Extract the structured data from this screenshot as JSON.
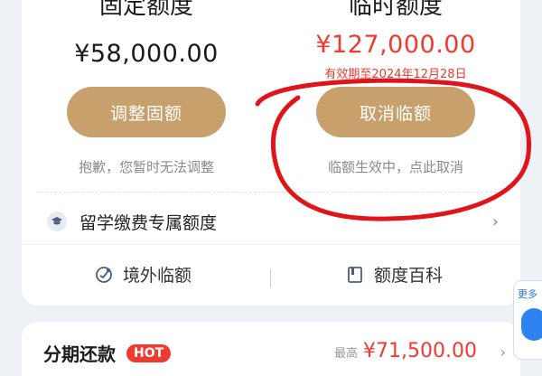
{
  "limits": {
    "fixed": {
      "title": "固定额度",
      "amount": "¥58,000.00",
      "button": "调整固额",
      "hint": "抱歉，您暂时无法调整"
    },
    "temporary": {
      "title": "临时额度",
      "amount": "¥127,000.00",
      "valid_until": "有效期至2024年12月28日",
      "button": "取消临额",
      "hint": "临额生效中，点此取消"
    }
  },
  "study_limit": {
    "label": "留学缴费专属额度",
    "icon": "graduation-cap-icon"
  },
  "quick_actions": [
    {
      "label": "境外临额",
      "icon": "overseas-limit-icon"
    },
    {
      "label": "额度百科",
      "icon": "book-icon"
    }
  ],
  "installment": {
    "title": "分期还款",
    "badge": "HOT",
    "due_label": "最高",
    "due_amount": "¥71,500.00"
  },
  "floating_widget": {
    "label": "更多"
  },
  "colors": {
    "accent_gold": "#c8a06c",
    "alert_red": "#ef3b2f",
    "annotation_red": "#e0141b"
  }
}
